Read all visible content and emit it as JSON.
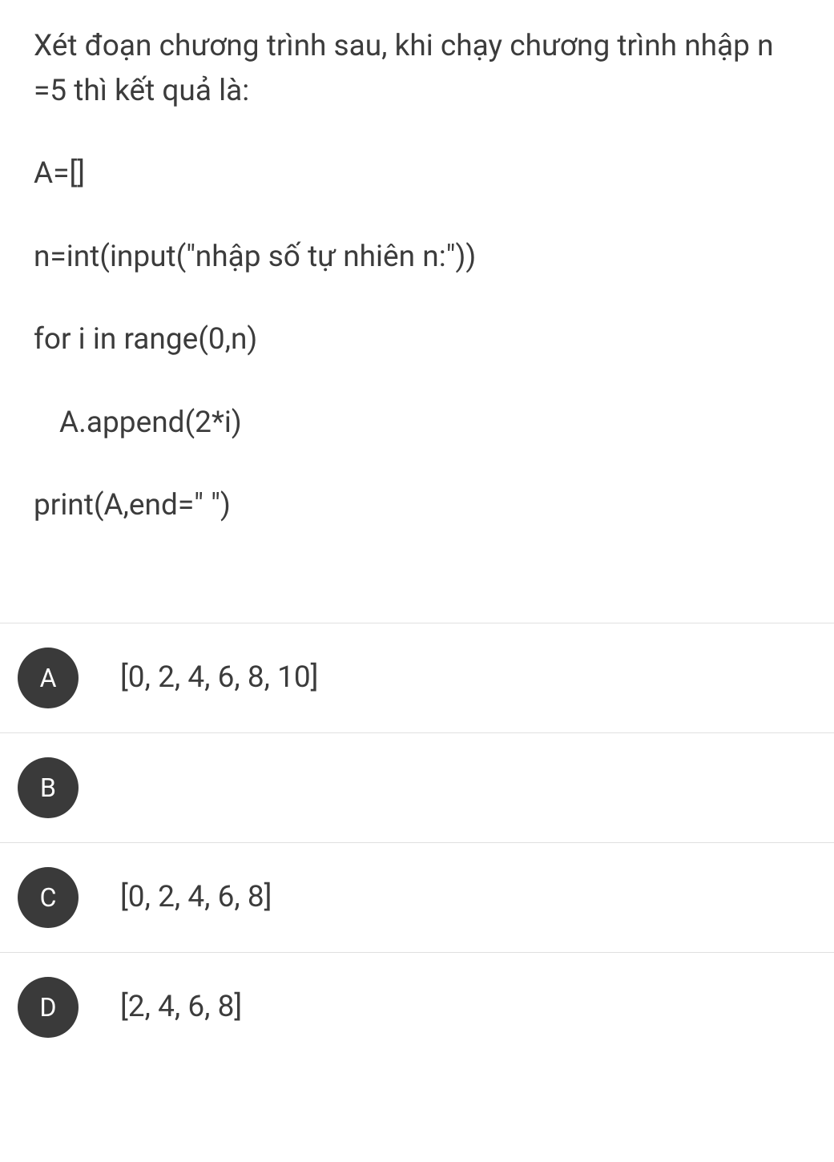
{
  "question": {
    "prompt": "Xét đoạn chương trình sau, khi chạy chương trình nhập n =5 thì kết quả là:",
    "code_lines": [
      "A=[]",
      "n=int(input(\"nhập số tự nhiên n:\"))",
      "for i in range(0,n)",
      "A.append(2*i)",
      "print(A,end=\" \")"
    ]
  },
  "answers": [
    {
      "letter": "A",
      "text": "[0, 2, 4, 6, 8, 10]"
    },
    {
      "letter": "B",
      "text": ""
    },
    {
      "letter": "C",
      "text": "[0, 2, 4, 6, 8]"
    },
    {
      "letter": "D",
      "text": "[2, 4, 6, 8]"
    }
  ]
}
